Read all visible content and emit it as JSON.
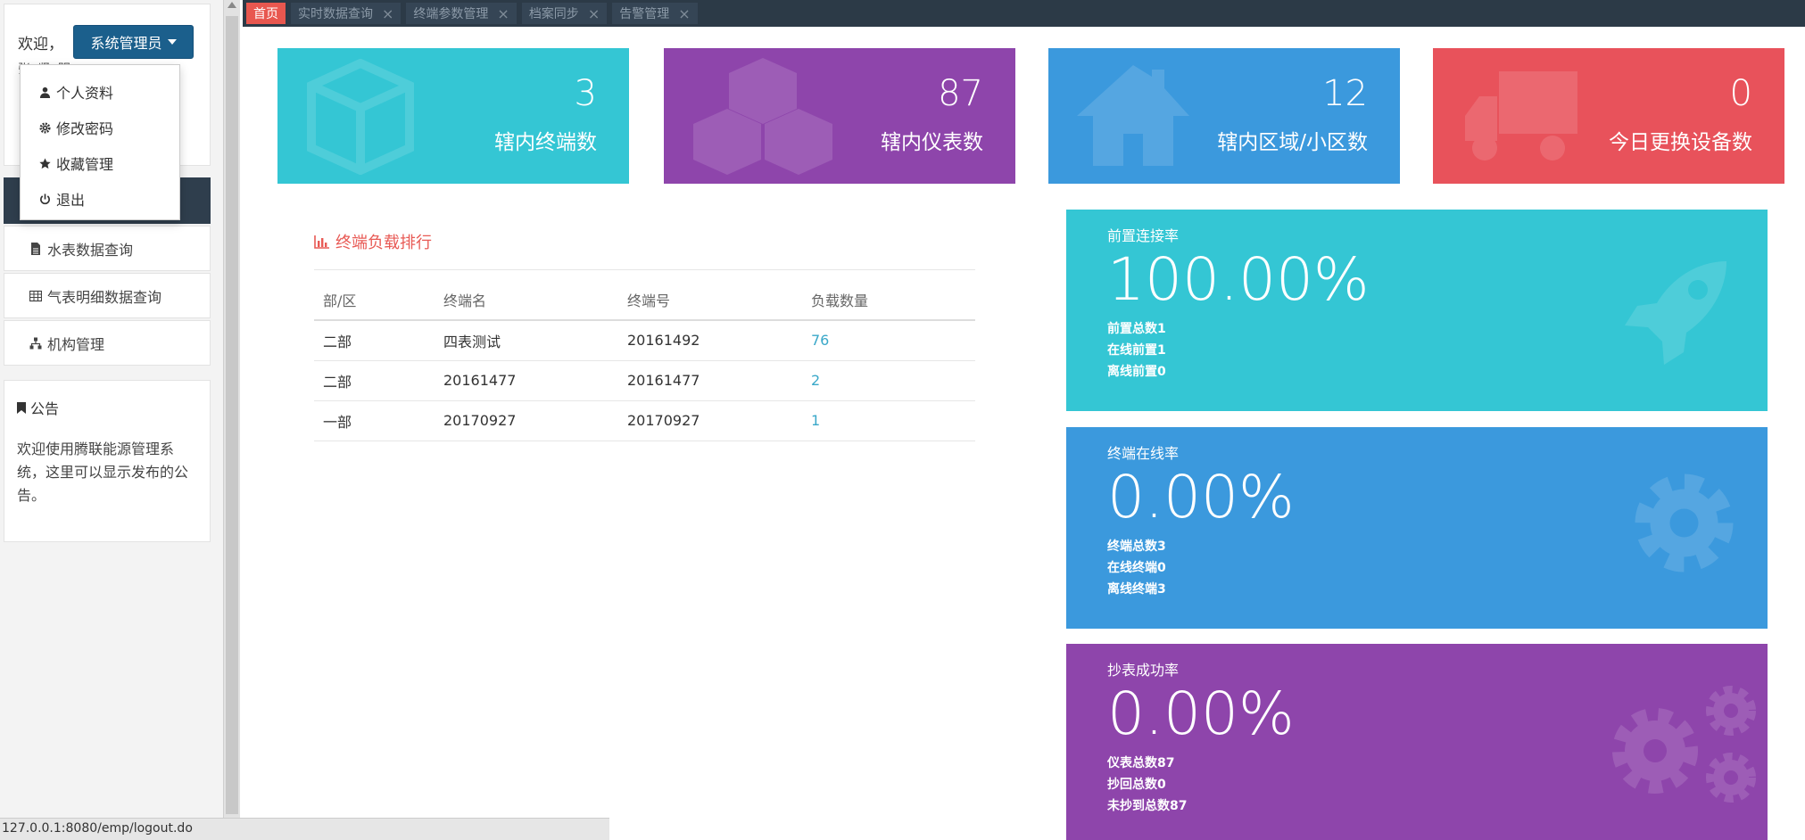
{
  "sidebar": {
    "welcome_text": "欢迎，",
    "welcome_cut": "张 贤 明",
    "admin_button": "系统管理员",
    "dropdown": [
      {
        "label": "个人资料",
        "icon": "user-icon"
      },
      {
        "label": "修改密码",
        "icon": "gear-icon"
      },
      {
        "label": "收藏管理",
        "icon": "star-icon"
      },
      {
        "label": "退出",
        "icon": "power-icon"
      }
    ],
    "menu": [
      {
        "label": "水表数据查询",
        "icon": "file-icon"
      },
      {
        "label": "气表明细数据查询",
        "icon": "table-icon"
      },
      {
        "label": "机构管理",
        "icon": "sitemap-icon"
      }
    ],
    "notice_title": "公告",
    "notice_body": "欢迎使用腾联能源管理系统，这里可以显示发布的公告。"
  },
  "status_bar": "127.0.0.1:8080/emp/logout.do",
  "tabs": [
    {
      "label": "首页",
      "active": true
    },
    {
      "label": "实时数据查询"
    },
    {
      "label": "终端参数管理"
    },
    {
      "label": "档案同步"
    },
    {
      "label": "告警管理"
    }
  ],
  "cards": [
    {
      "value": "3",
      "label": "辖内终端数",
      "color": "#34c6d4",
      "icon": "cube-icon"
    },
    {
      "value": "87",
      "label": "辖内仪表数",
      "color": "#8e45ab",
      "icon": "cubes-icon"
    },
    {
      "value": "12",
      "label": "辖内区域/小区数",
      "color": "#3b99dd",
      "icon": "home-icon"
    },
    {
      "value": "0",
      "label": "今日更换设备数",
      "color": "#e8525b",
      "icon": "truck-icon"
    }
  ],
  "ranking": {
    "title": "终端负载排行",
    "headers": [
      "部/区",
      "终端名",
      "终端号",
      "负载数量"
    ],
    "rows": [
      [
        "二部",
        "四表测试",
        "20161492",
        "76"
      ],
      [
        "二部",
        "20161477",
        "20161477",
        "2"
      ],
      [
        "一部",
        "20170927",
        "20170927",
        "1"
      ]
    ]
  },
  "stats": [
    {
      "title": "前置连接率",
      "value": "100.00%",
      "lines": [
        "前置总数1",
        "在线前置1",
        "离线前置0"
      ],
      "color": "#34c6d4",
      "icon": "rocket-icon"
    },
    {
      "title": "终端在线率",
      "value": "0.00%",
      "lines": [
        "终端总数3",
        "在线终端0",
        "离线终端3"
      ],
      "color": "#3b99dd",
      "icon": "gear-icon"
    },
    {
      "title": "抄表成功率",
      "value": "0.00%",
      "lines": [
        "仪表总数87",
        "抄回总数0",
        "未抄到总数87"
      ],
      "color": "#8e45ab",
      "icon": "gears-icon"
    }
  ]
}
